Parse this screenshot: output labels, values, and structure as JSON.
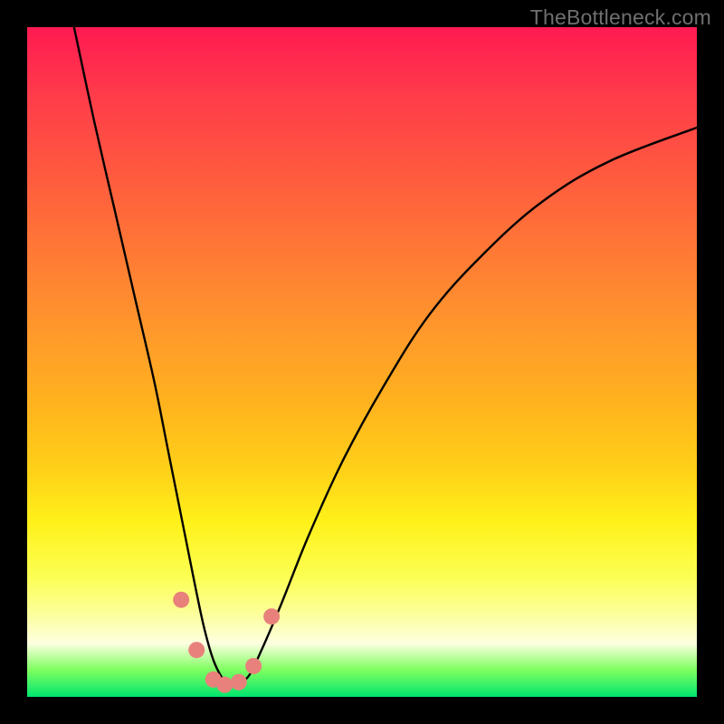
{
  "watermark": "TheBottleneck.com",
  "chart_data": {
    "type": "line",
    "title": "",
    "xlabel": "",
    "ylabel": "",
    "xlim": [
      0,
      100
    ],
    "ylim": [
      0,
      100
    ],
    "series": [
      {
        "name": "bottleneck-curve",
        "x": [
          7,
          10,
          13,
          16,
          19,
          21,
          23,
          25,
          26.5,
          28,
          29.8,
          31,
          33,
          35,
          38,
          42,
          47,
          53,
          60,
          68,
          77,
          87,
          100
        ],
        "values": [
          100,
          86,
          73,
          60,
          47,
          37,
          27,
          17,
          10,
          5,
          2,
          2,
          3,
          7,
          14,
          24,
          35,
          46,
          57,
          66,
          74,
          80,
          85
        ]
      },
      {
        "name": "marker-dots",
        "x": [
          23.0,
          25.3,
          27.8,
          29.5,
          31.6,
          33.8,
          36.5
        ],
        "values": [
          14.5,
          7.0,
          2.6,
          1.8,
          2.2,
          4.6,
          12.0
        ]
      }
    ],
    "colors": {
      "curve": "#000000",
      "markers": "#e8817b",
      "gradient_top": "#ff1a52",
      "gradient_bottom": "#00e56e"
    }
  }
}
